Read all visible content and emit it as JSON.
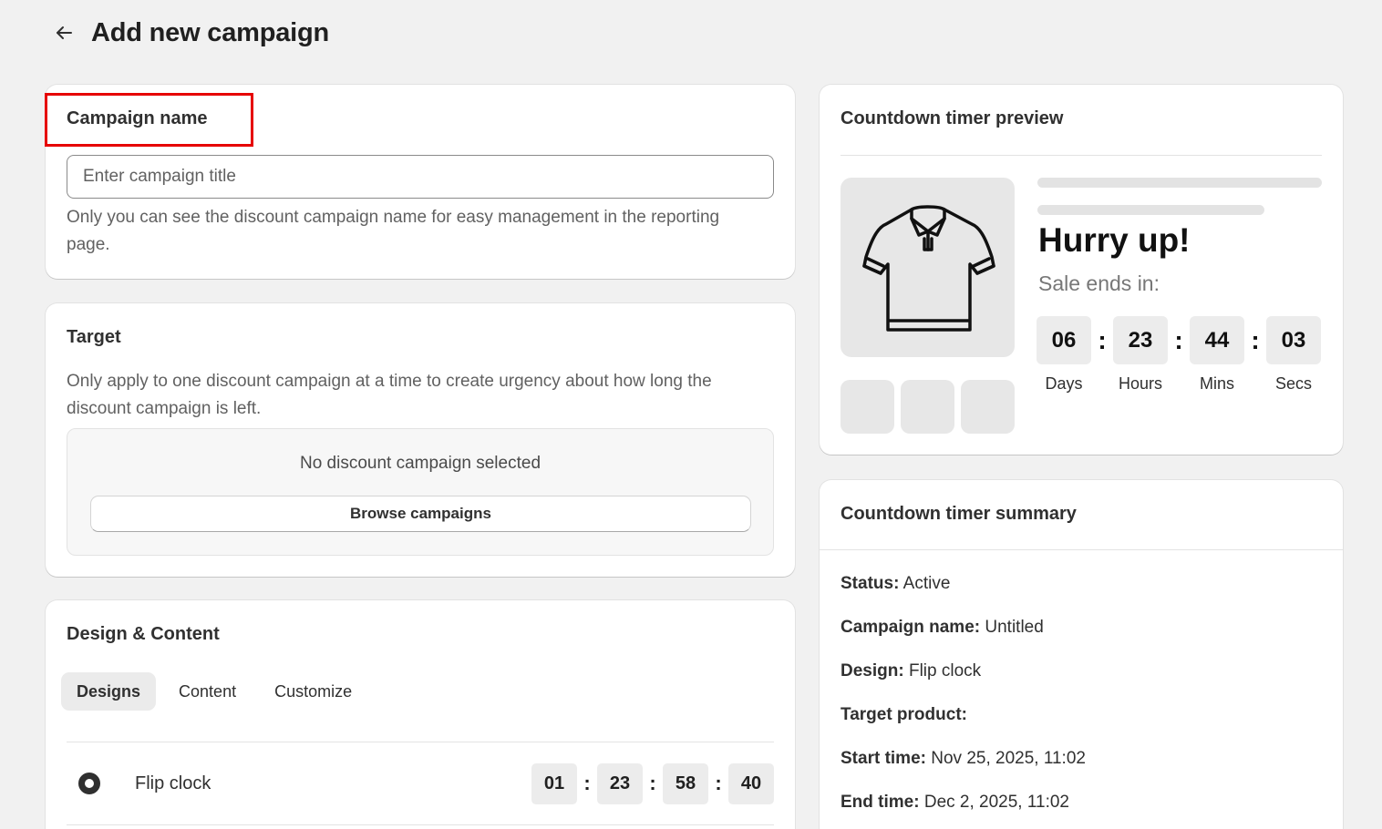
{
  "page": {
    "title": "Add new campaign"
  },
  "campaign_name": {
    "title": "Campaign name",
    "placeholder": "Enter campaign title",
    "value": "",
    "help": "Only you can see the discount campaign name for easy management in the reporting page."
  },
  "target": {
    "title": "Target",
    "help": "Only apply to one discount campaign at a time to create urgency about how long the discount campaign is left.",
    "empty_text": "No discount campaign selected",
    "browse_label": "Browse campaigns"
  },
  "design": {
    "title": "Design & Content",
    "tabs": [
      {
        "label": "Designs",
        "active": true
      },
      {
        "label": "Content",
        "active": false
      },
      {
        "label": "Customize",
        "active": false
      }
    ],
    "options": [
      {
        "name": "Flip clock",
        "selected": true,
        "digits": [
          "01",
          "23",
          "58",
          "40"
        ]
      }
    ]
  },
  "preview": {
    "title": "Countdown timer preview",
    "headline": "Hurry up!",
    "subtext": "Sale ends in:",
    "timer": [
      {
        "value": "06",
        "label": "Days"
      },
      {
        "value": "23",
        "label": "Hours"
      },
      {
        "value": "44",
        "label": "Mins"
      },
      {
        "value": "03",
        "label": "Secs"
      }
    ],
    "product_icon": "polo-shirt-icon"
  },
  "summary": {
    "title": "Countdown timer summary",
    "rows": [
      {
        "label": "Status:",
        "value": "Active"
      },
      {
        "label": "Campaign name:",
        "value": "Untitled"
      },
      {
        "label": "Design:",
        "value": "Flip clock"
      },
      {
        "label": "Target product:",
        "value": ""
      },
      {
        "label": "Start time:",
        "value": "Nov 25, 2025, 11:02"
      },
      {
        "label": "End time:",
        "value": "Dec 2, 2025, 11:02"
      }
    ]
  },
  "colors": {
    "highlight": "#e60000",
    "background": "#f1f1f1"
  }
}
